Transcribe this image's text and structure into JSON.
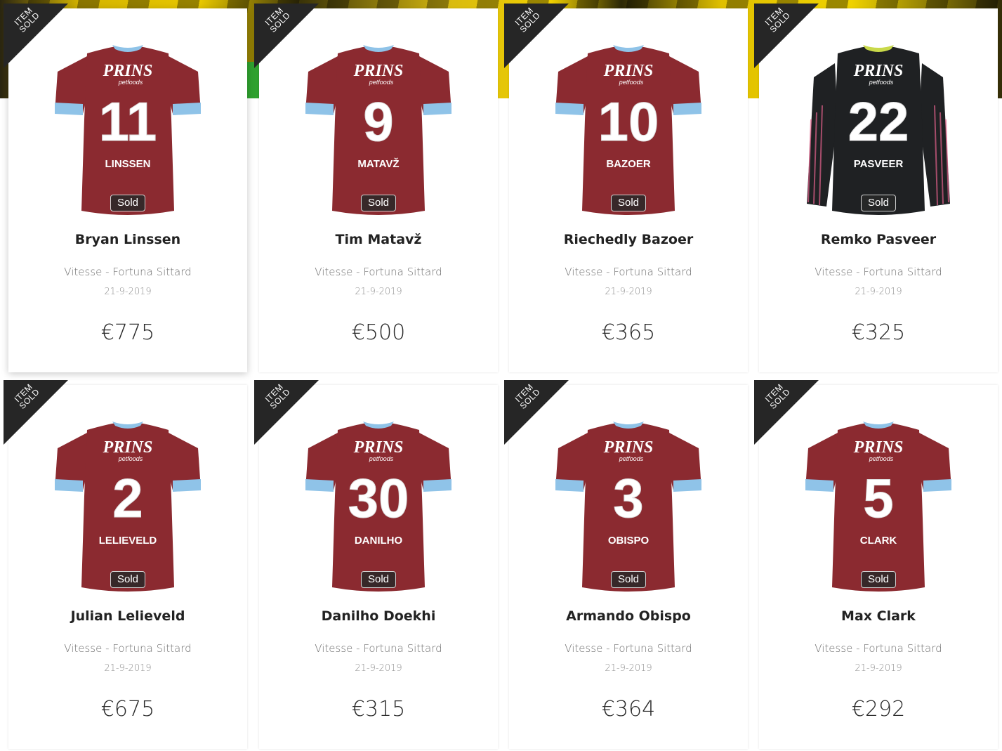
{
  "ribbon_text": [
    "ITEM",
    "SOLD"
  ],
  "sold_label": "Sold",
  "sponsor": {
    "name": "PRINS",
    "sub": "petfoods"
  },
  "colors": {
    "home_shirt": "#8b2a30",
    "sleeve_trim": "#8fc3e8",
    "keeper_shirt": "#1f2123",
    "keeper_trim": "#e0608a",
    "ribbon": "#262626"
  },
  "items": [
    {
      "player": "Bryan Linssen",
      "number": "11",
      "shirt_name": "LINSSEN",
      "match": "Vitesse - Fortuna Sittard",
      "date": "21-9-2019",
      "price": "€775",
      "shirt": "home"
    },
    {
      "player": "Tim Matavž",
      "number": "9",
      "shirt_name": "MATAVŽ",
      "match": "Vitesse - Fortuna Sittard",
      "date": "21-9-2019",
      "price": "€500",
      "shirt": "home"
    },
    {
      "player": "Riechedly Bazoer",
      "number": "10",
      "shirt_name": "BAZOER",
      "match": "Vitesse - Fortuna Sittard",
      "date": "21-9-2019",
      "price": "€365",
      "shirt": "home"
    },
    {
      "player": "Remko Pasveer",
      "number": "22",
      "shirt_name": "PASVEER",
      "match": "Vitesse - Fortuna Sittard",
      "date": "21-9-2019",
      "price": "€325",
      "shirt": "keeper"
    },
    {
      "player": "Julian Lelieveld",
      "number": "2",
      "shirt_name": "LELIEVELD",
      "match": "Vitesse - Fortuna Sittard",
      "date": "21-9-2019",
      "price": "€675",
      "shirt": "home"
    },
    {
      "player": "Danilho Doekhi",
      "number": "30",
      "shirt_name": "DANILHO",
      "match": "Vitesse - Fortuna Sittard",
      "date": "21-9-2019",
      "price": "€315",
      "shirt": "home"
    },
    {
      "player": "Armando Obispo",
      "number": "3",
      "shirt_name": "OBISPO",
      "match": "Vitesse - Fortuna Sittard",
      "date": "21-9-2019",
      "price": "€364",
      "shirt": "home"
    },
    {
      "player": "Max Clark",
      "number": "5",
      "shirt_name": "CLARK",
      "match": "Vitesse - Fortuna Sittard",
      "date": "21-9-2019",
      "price": "€292",
      "shirt": "home"
    }
  ]
}
